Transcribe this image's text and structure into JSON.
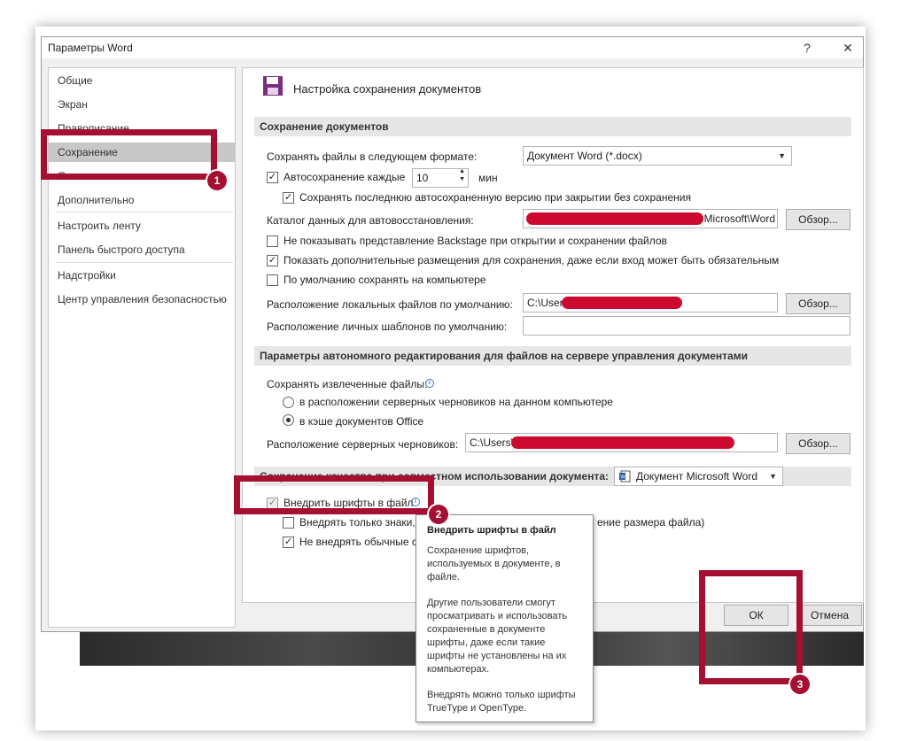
{
  "window": {
    "title": "Параметры Word",
    "help_glyph": "?",
    "close_glyph": "✕"
  },
  "sidebar": {
    "items": [
      {
        "label": "Общие"
      },
      {
        "label": "Экран"
      },
      {
        "label": "Правописание"
      },
      {
        "label": "Сохранение"
      },
      {
        "label": "Язык"
      },
      {
        "label": "Дополнительно"
      },
      {
        "label": "Настроить ленту"
      },
      {
        "label": "Панель быстрого доступа"
      },
      {
        "label": "Надстройки"
      },
      {
        "label": "Центр управления безопасностью"
      }
    ],
    "selected": "Сохранение"
  },
  "content": {
    "title": "Настройка сохранения документов",
    "save_docs": {
      "header": "Сохранение документов",
      "format_label": "Сохранять файлы в следующем формате:",
      "format_value": "Документ Word (*.docx)",
      "autosave_label": "Автосохранение каждые",
      "autosave_value": "10",
      "autosave_unit": "мин",
      "keep_last_label": "Сохранять последнюю автосохраненную версию при закрытии без сохранения",
      "autorecover_label": "Каталог данных для автовосстановления:",
      "autorecover_value": "Microsoft\\Word",
      "browse_label": "Обзор...",
      "no_backstage_label": "Не показывать представление Backstage при открытии и сохранении файлов",
      "show_additional_label": "Показать дополнительные размещения для сохранения, даже если вход может быть обязательным",
      "save_local_label": "По умолчанию сохранять на компьютере",
      "local_location_label": "Расположение локальных файлов по умолчанию:",
      "local_location_value": "C:\\Users\\",
      "templates_label": "Расположение личных шаблонов по умолчанию:",
      "templates_value": ""
    },
    "offline": {
      "header": "Параметры автономного редактирования для файлов на сервере управления документами",
      "save_checked_label": "Сохранять извлеченные файлы:",
      "option_server_label": "в расположении серверных черновиков на данном компьютере",
      "option_cache_label": "в кэше документов Office",
      "drafts_label": "Расположение серверных черновиков:",
      "drafts_value": "C:\\Users\\"
    },
    "fidelity": {
      "header": "Сохранение качества при совместном использовании документа:",
      "doc_value": "Документ Microsoft Word",
      "embed_fonts_label": "Внедрить шрифты в файл",
      "embed_only_used_label": "Внедрять только знаки, и",
      "embed_only_used_suffix": "ение размера файла)",
      "no_common_label": "Не внедрять обычные си"
    }
  },
  "tooltip": {
    "title": "Внедрить шрифты в файл",
    "p1": "Сохранение шрифтов, используемых в документе, в файле.",
    "p2": "Другие пользователи смогут просматривать и использовать сохраненные в документе шрифты, даже если такие шрифты не установлены на их компьютерах.",
    "p3": "Внедрять можно только шрифты TrueType и OpenType."
  },
  "footer": {
    "ok_label": "ОК",
    "cancel_label": "Отмена"
  },
  "annotations": {
    "badge_1": "1",
    "badge_2": "2",
    "badge_3": "3",
    "highlight_color": "#a50f31"
  },
  "icons": {
    "save": "floppy-disk-icon",
    "word_doc": "word-document-icon",
    "info": "info-icon",
    "dropdown": "chevron-down-icon"
  }
}
